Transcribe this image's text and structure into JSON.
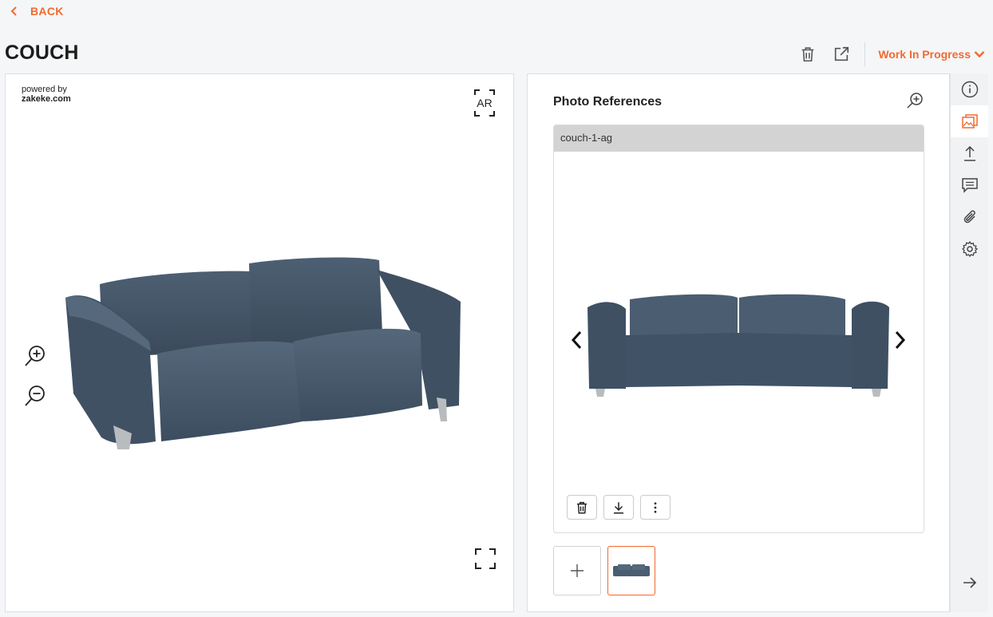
{
  "nav": {
    "back_label": "BACK"
  },
  "page": {
    "title": "COUCH"
  },
  "header": {
    "status_label": "Work In Progress",
    "accent_color": "#f26a2e",
    "icons": [
      "trash-icon",
      "external-link-icon",
      "chevron-down-icon"
    ]
  },
  "viewer": {
    "powered_by": "powered by",
    "brand": "zakeke.com",
    "ar_label": "AR",
    "icons": [
      "zoom-in-icon",
      "zoom-out-icon",
      "fullscreen-icon",
      "ar-icon"
    ]
  },
  "panel": {
    "title": "Photo References",
    "reference_name": "couch-1-ag",
    "icons": [
      "zoom-in-icon",
      "chevron-left-icon",
      "chevron-right-icon",
      "trash-icon",
      "download-icon",
      "more-vertical-icon",
      "plus-icon"
    ]
  },
  "sidebar": {
    "items": [
      {
        "name": "info",
        "icon": "info-icon",
        "active": false
      },
      {
        "name": "photo-references",
        "icon": "images-icon",
        "active": true
      },
      {
        "name": "upload",
        "icon": "upload-icon",
        "active": false
      },
      {
        "name": "comments",
        "icon": "comment-icon",
        "active": false
      },
      {
        "name": "attachments",
        "icon": "paperclip-icon",
        "active": false
      },
      {
        "name": "settings",
        "icon": "gear-icon",
        "active": false
      }
    ],
    "collapse_icon": "arrow-right-icon"
  }
}
